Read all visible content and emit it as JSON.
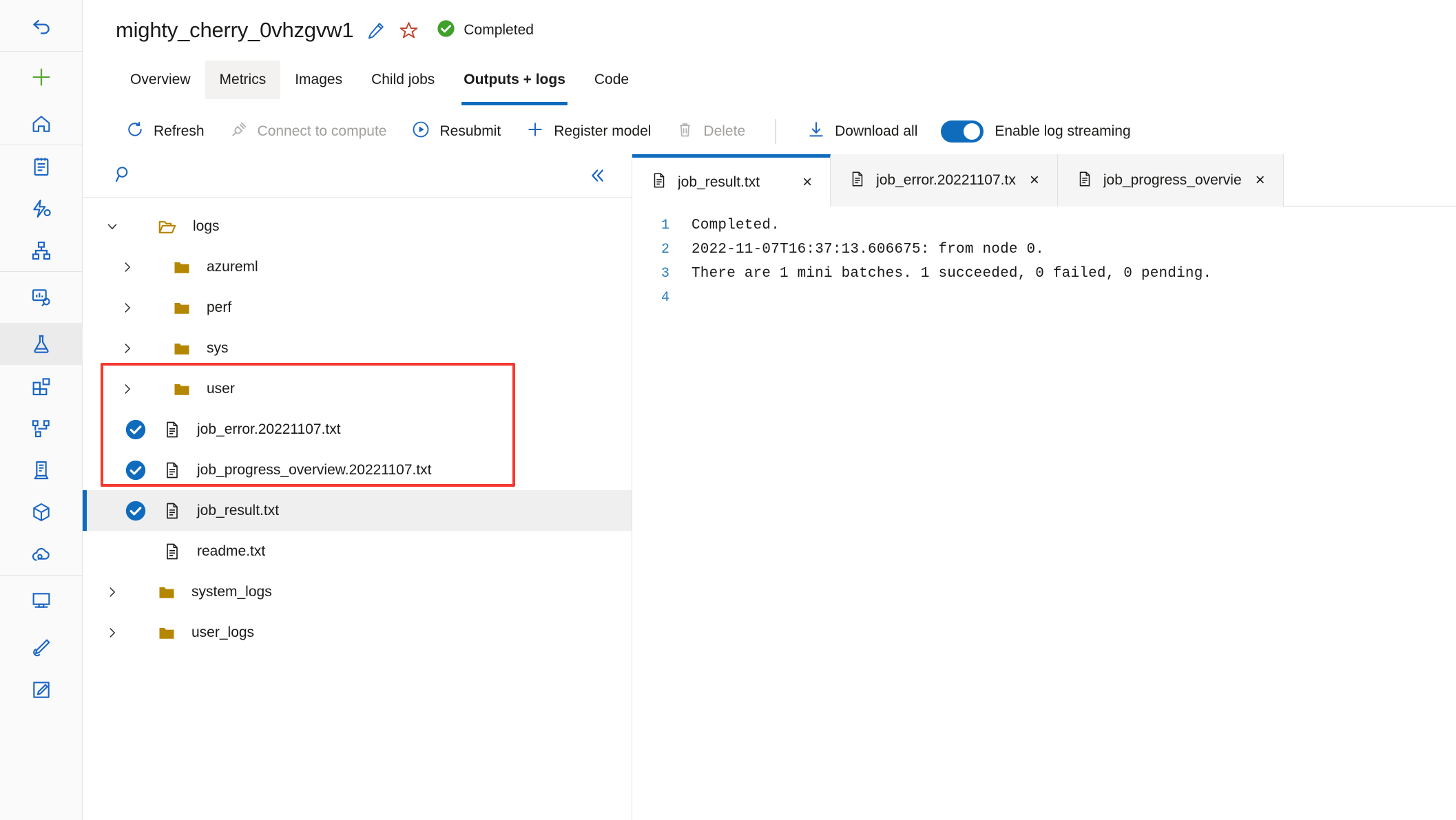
{
  "rail": {
    "items": [
      {
        "name": "back-icon",
        "label": "Back"
      },
      {
        "name": "new-icon",
        "label": "New"
      },
      {
        "name": "home-icon",
        "label": "Home"
      },
      {
        "name": "notebooks-icon",
        "label": "Notebooks"
      },
      {
        "name": "automated-ml-icon",
        "label": "Automated ML"
      },
      {
        "name": "designer-pipeline-icon",
        "label": "Designer"
      },
      {
        "name": "data-monitor-icon",
        "label": "Data"
      },
      {
        "name": "experiments-flask-icon",
        "label": "Jobs"
      },
      {
        "name": "components-icon",
        "label": "Components"
      },
      {
        "name": "pipelines-icon",
        "label": "Pipelines"
      },
      {
        "name": "compute-icon",
        "label": "Compute"
      },
      {
        "name": "models-cube-icon",
        "label": "Models"
      },
      {
        "name": "endpoints-cloud-icon",
        "label": "Endpoints"
      },
      {
        "name": "monitor-icon",
        "label": "Compute instances"
      },
      {
        "name": "labeling-pen-icon",
        "label": "Data labeling"
      },
      {
        "name": "edit-square-icon",
        "label": "Designer"
      }
    ]
  },
  "header": {
    "job_title": "mighty_cherry_0vhzgvw1",
    "edit_icon": "pencil-icon",
    "favorite_icon": "star-icon",
    "status_icon": "check-circle-icon",
    "status_text": "Completed",
    "status_color": "#1f9b1f",
    "star_color": "#c0452b",
    "accent_color": "#0f6cbd"
  },
  "tabs": [
    {
      "label": "Overview",
      "state": "normal"
    },
    {
      "label": "Metrics",
      "state": "hovered"
    },
    {
      "label": "Images",
      "state": "normal"
    },
    {
      "label": "Child jobs",
      "state": "normal"
    },
    {
      "label": "Outputs + logs",
      "state": "active"
    },
    {
      "label": "Code",
      "state": "normal"
    }
  ],
  "toolbar": {
    "refresh": {
      "label": "Refresh",
      "icon": "refresh-icon",
      "disabled": false
    },
    "connect": {
      "label": "Connect to compute",
      "icon": "plug-icon",
      "disabled": true
    },
    "resubmit": {
      "label": "Resubmit",
      "icon": "play-circle-icon",
      "disabled": false
    },
    "register": {
      "label": "Register model",
      "icon": "plus-icon",
      "disabled": false
    },
    "delete": {
      "label": "Delete",
      "icon": "trash-icon",
      "disabled": true
    },
    "download_all": {
      "label": "Download all",
      "icon": "download-icon",
      "disabled": false
    },
    "log_streaming": {
      "label": "Enable log streaming",
      "enabled": true
    }
  },
  "tree_panel": {
    "search": {
      "value": "",
      "placeholder": "",
      "icon": "search-icon"
    },
    "collapse_icon": "double-chevron-left-icon",
    "nodes": [
      {
        "label": "logs",
        "type": "folder-open",
        "depth": 0,
        "expanded": true,
        "chevron": "chevron-down",
        "checkbox": null,
        "selected": false
      },
      {
        "label": "azureml",
        "type": "folder",
        "depth": 1,
        "expanded": false,
        "chevron": "chevron-right",
        "checkbox": null,
        "selected": false
      },
      {
        "label": "perf",
        "type": "folder",
        "depth": 1,
        "expanded": false,
        "chevron": "chevron-right",
        "checkbox": null,
        "selected": false
      },
      {
        "label": "sys",
        "type": "folder",
        "depth": 1,
        "expanded": false,
        "chevron": "chevron-right",
        "checkbox": null,
        "selected": false
      },
      {
        "label": "user",
        "type": "folder",
        "depth": 1,
        "expanded": false,
        "chevron": "chevron-right",
        "checkbox": null,
        "selected": false
      },
      {
        "label": "job_error.20221107.txt",
        "type": "file",
        "depth": 1,
        "expanded": false,
        "chevron": null,
        "checkbox": "checked",
        "selected": false
      },
      {
        "label": "job_progress_overview.20221107.txt",
        "type": "file",
        "depth": 1,
        "expanded": false,
        "chevron": null,
        "checkbox": "checked",
        "selected": false
      },
      {
        "label": "job_result.txt",
        "type": "file",
        "depth": 1,
        "expanded": false,
        "chevron": null,
        "checkbox": "checked",
        "selected": true
      },
      {
        "label": "readme.txt",
        "type": "file",
        "depth": 1,
        "expanded": false,
        "chevron": null,
        "checkbox": null,
        "selected": false
      },
      {
        "label": "system_logs",
        "type": "folder",
        "depth": 0,
        "expanded": false,
        "chevron": "chevron-right",
        "checkbox": null,
        "selected": false
      },
      {
        "label": "user_logs",
        "type": "folder",
        "depth": 0,
        "expanded": false,
        "chevron": "chevron-right",
        "checkbox": null,
        "selected": false
      }
    ],
    "annotation": {
      "color": "#f4392f",
      "covers": "three selected log files"
    }
  },
  "viewer": {
    "file_tabs": [
      {
        "label": "job_result.txt",
        "active": true,
        "icon": "file-icon",
        "close": "×"
      },
      {
        "label": "job_error.20221107.tx",
        "active": false,
        "icon": "file-icon",
        "close": "×"
      },
      {
        "label": "job_progress_overvie",
        "active": false,
        "icon": "file-icon",
        "close": "×"
      }
    ],
    "lines": [
      {
        "n": "1",
        "text": "Completed."
      },
      {
        "n": "2",
        "text": "2022-11-07T16:37:13.606675: from node 0."
      },
      {
        "n": "3",
        "text": "There are 1 mini batches. 1 succeeded, 0 failed, 0 pending."
      },
      {
        "n": "4",
        "text": ""
      }
    ]
  }
}
